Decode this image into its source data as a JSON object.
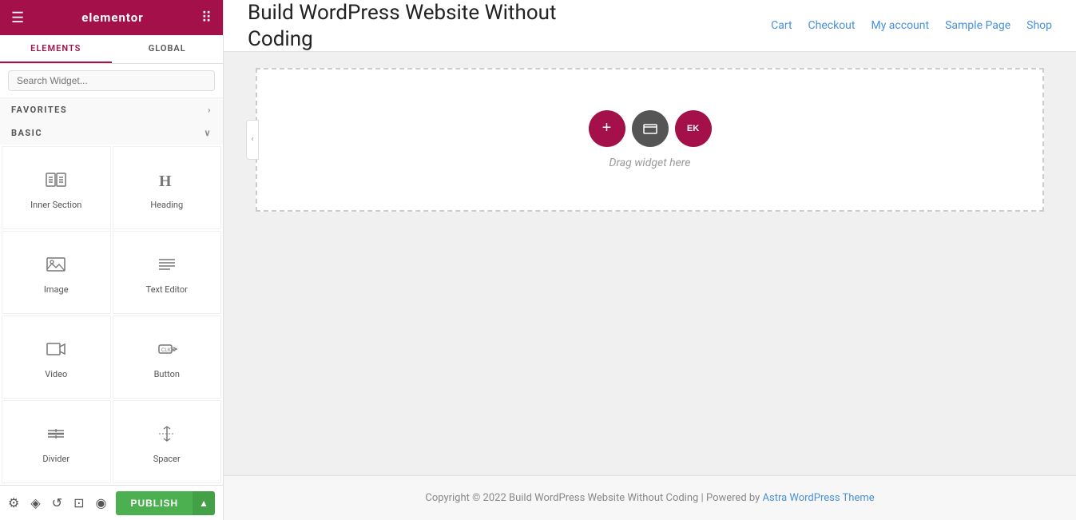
{
  "sidebar": {
    "logo": "elementor",
    "tabs": [
      {
        "label": "ELEMENTS",
        "active": true
      },
      {
        "label": "GLOBAL",
        "active": false
      }
    ],
    "search": {
      "placeholder": "Search Widget..."
    },
    "favorites": {
      "label": "FAVORITES",
      "chevron": "›"
    },
    "basic": {
      "label": "BASIC",
      "chevron": "∨"
    },
    "widgets": [
      {
        "id": "inner-section",
        "label": "Inner Section",
        "icon": "inner-section-icon"
      },
      {
        "id": "heading",
        "label": "Heading",
        "icon": "heading-icon"
      },
      {
        "id": "image",
        "label": "Image",
        "icon": "image-icon"
      },
      {
        "id": "text-editor",
        "label": "Text Editor",
        "icon": "text-editor-icon"
      },
      {
        "id": "video",
        "label": "Video",
        "icon": "video-icon"
      },
      {
        "id": "button",
        "label": "Button",
        "icon": "button-icon"
      },
      {
        "id": "divider",
        "label": "Divider",
        "icon": "divider-icon"
      },
      {
        "id": "spacer",
        "label": "Spacer",
        "icon": "spacer-icon"
      }
    ],
    "bottom_icons": [
      "settings-icon",
      "layers-icon",
      "history-icon",
      "navigator-icon",
      "eye-icon"
    ]
  },
  "bottom_bar": {
    "publish_label": "PUBLISH",
    "publish_arrow": "▲"
  },
  "top_nav": {
    "site_title_line1": "Build WordPress Website Without",
    "site_title_line2": "Coding",
    "nav_links": [
      {
        "label": "Cart"
      },
      {
        "label": "Checkout"
      },
      {
        "label": "My account"
      },
      {
        "label": "Sample Page"
      },
      {
        "label": "Shop"
      }
    ]
  },
  "canvas": {
    "drop_zone": {
      "hint": "Drag widget here",
      "buttons": [
        {
          "type": "add",
          "symbol": "+"
        },
        {
          "type": "folder",
          "symbol": "▣"
        },
        {
          "type": "edit",
          "symbol": "EK"
        }
      ]
    }
  },
  "footer": {
    "text": "Copyright © 2022 Build WordPress Website Without Coding | Powered by ",
    "link_text": "Astra WordPress Theme",
    "link_href": "#"
  }
}
